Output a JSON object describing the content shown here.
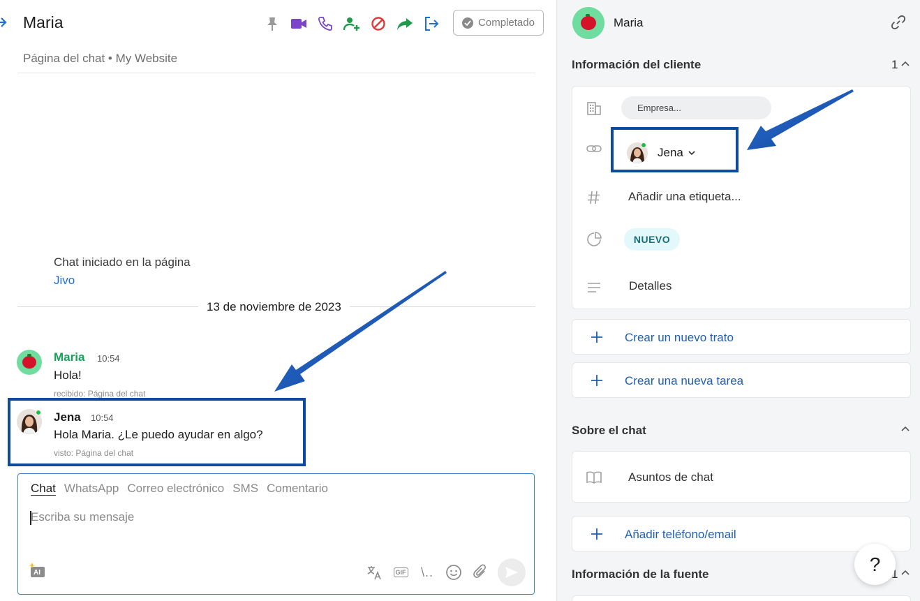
{
  "chat": {
    "title": "Maria",
    "subtitle": "Página del chat • My Website",
    "completed_label": "Completado",
    "toolbar_icons": [
      "pin-icon",
      "video-call-icon",
      "phone-icon",
      "add-user-icon",
      "block-icon",
      "forward-icon",
      "exit-icon"
    ],
    "system_message": "Chat iniciado en la página",
    "system_link": "Jivo",
    "date_separator": "13 de noviembre de 2023",
    "messages": [
      {
        "name": "Maria",
        "time": "10:54",
        "text": "Hola!",
        "meta": "recibido: Página del chat",
        "name_color": "#19a05a"
      },
      {
        "name": "Jena",
        "time": "10:54",
        "text": "Hola Maria. ¿Le puedo ayudar en algo?",
        "meta": "visto: Página del chat",
        "name_color": "#1c1c1c"
      }
    ]
  },
  "compose": {
    "tabs": [
      "Chat",
      "WhatsApp",
      "Correo electrónico",
      "SMS",
      "Comentario"
    ],
    "active_tab": "Chat",
    "placeholder": "Escriba su mensaje",
    "ai_label": "AI",
    "gif_label": "GIF",
    "snippet_label": "\\.."
  },
  "client_panel": {
    "name": "Maria",
    "client_info_title": "Información del cliente",
    "client_info_count": "1",
    "company_placeholder": "Empresa...",
    "assigned_agent": "Jena",
    "tag_placeholder": "Añadir una etiqueta...",
    "status": "NUEVO",
    "details_label": "Detalles",
    "create_deal": "Crear un nuevo trato",
    "create_task": "Crear una nueva tarea",
    "about_chat_title": "Sobre el chat",
    "chat_topics": "Asuntos de chat",
    "add_contact": "Añadir teléfono/email",
    "source_info_title": "Información de la fuente",
    "source_info_count": "1"
  },
  "help_label": "?",
  "colors": {
    "accent_blue": "#1f5fb0",
    "highlight_border": "#0f4aa1",
    "online_green": "#1bbf3c",
    "maria_green": "#19a05a",
    "status_badge_bg": "#e2f8fb"
  }
}
